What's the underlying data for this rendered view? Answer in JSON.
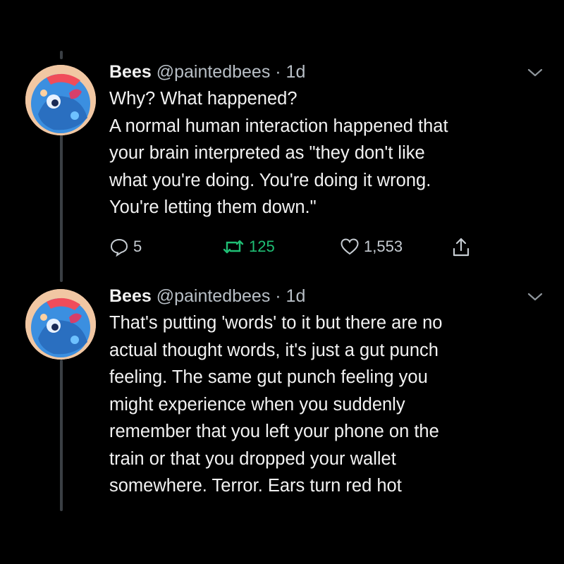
{
  "tweets": [
    {
      "name": "Bees",
      "handle": "@paintedbees",
      "time": "· 1d",
      "lines": [
        "Why? What happened?",
        "A normal human interaction happened that",
        "your brain interpreted as \"they don't like",
        "what you're doing. You're doing it wrong.",
        "You're letting them down.\""
      ],
      "reply_count": "5",
      "retweet_count": "125",
      "like_count": "1,553"
    },
    {
      "name": "Bees",
      "handle": "@paintedbees",
      "time": "· 1d",
      "lines": [
        "That's putting 'words' to it but there are no",
        "actual thought words, it's just a gut punch",
        "feeling. The same gut punch feeling you",
        "might experience when you suddenly",
        "remember that you left your phone on the",
        "train or that you dropped your wallet",
        "somewhere. Terror. Ears turn red hot"
      ]
    }
  ],
  "colors": {
    "background": "#000000",
    "thread_line": "#3a3f44",
    "retweet_accent": "#1fbf75",
    "secondary_text": "#b8bfc6"
  },
  "icons": {
    "reply": "speech-bubble-icon",
    "retweet": "retweet-arrows-icon",
    "like": "heart-outline-icon",
    "share": "share-upload-icon",
    "more": "chevron-down-icon"
  }
}
